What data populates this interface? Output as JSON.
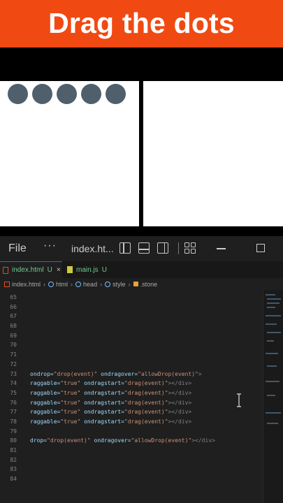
{
  "banner": {
    "title": "Drag the dots"
  },
  "dots": {
    "count": 5,
    "color": "#4f5f6c"
  },
  "colors": {
    "banner": "#f04a12",
    "accent": "#0078d4"
  },
  "titlebar": {
    "menu_file": "File",
    "menu_more": "···",
    "file_name": "index.ht...",
    "icons": [
      "toggle-sidebar-icon",
      "toggle-panel-icon",
      "toggle-secondary-sidebar-icon",
      "customize-layout-icon",
      "minimize-icon",
      "maximize-icon"
    ]
  },
  "tabs": [
    {
      "label": "index.html",
      "status": "U",
      "close": "×"
    },
    {
      "label": "main.js",
      "status": "U"
    }
  ],
  "breadcrumb": [
    "index.html",
    "html",
    "head",
    "style",
    ".stone"
  ],
  "line_numbers": [
    "65",
    "66",
    "67",
    "68",
    "69",
    "70",
    "71",
    "72",
    "73",
    "74",
    "75",
    "76",
    "77",
    "78",
    "79",
    "80",
    "81",
    "82",
    "83",
    "84"
  ],
  "code_lines": [
    {
      "a": "ondrop=",
      "s": "\"drop(event)\"",
      "b": " ondragover=",
      "t": "\"allowDrop(event)\"",
      "c": ">"
    },
    {
      "a": "raggable=",
      "s": "\"true\"",
      "b": " ondragstart=",
      "t": "\"drag(event)\"",
      "c": "></div>"
    },
    {
      "a": "raggable=",
      "s": "\"true\"",
      "b": " ondragstart=",
      "t": "\"drag(event)\"",
      "c": "></div>"
    },
    {
      "a": "raggable=",
      "s": "\"true\"",
      "b": " ondragstart=",
      "t": "\"drag(event)\"",
      "c": "></div>"
    },
    {
      "a": "raggable=",
      "s": "\"true\"",
      "b": " ondragstart=",
      "t": "\"drag(event)\"",
      "c": "></div>"
    },
    {
      "a": "raggable=",
      "s": "\"true\"",
      "b": " ondragstart=",
      "t": "\"drag(event)\"",
      "c": "></div>"
    },
    {
      "a": "drop=",
      "s": "\"drop(event)\"",
      "b": " ondragover=",
      "t": "\"allowDrop(event)\"",
      "c": "></div>"
    }
  ]
}
